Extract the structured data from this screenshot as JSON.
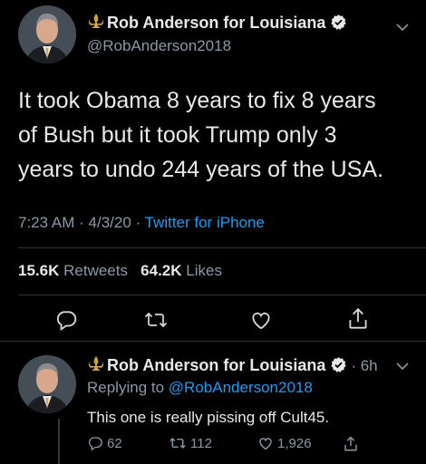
{
  "tweet": {
    "author_name": "Rob Anderson for Louisiana",
    "author_handle": "@RobAnderson2018",
    "text_lines": [
      "It took Obama 8 years to fix 8 years",
      "of Bush but it took Trump only 3",
      "years to undo 244 years of the USA."
    ],
    "time": "7:23 AM",
    "date": "4/3/20",
    "separator": "·",
    "source": "Twitter for iPhone",
    "retweets_count": "15.6K",
    "retweets_label": "Retweets",
    "likes_count": "64.2K",
    "likes_label": "Likes"
  },
  "reply": {
    "author_name": "Rob Anderson for Louisiana",
    "age": "· 6h",
    "replying_to_label": "Replying to",
    "replying_to_handle": "@RobAnderson2018",
    "text": "This one is really pissing off Cult45.",
    "reply_count": "62",
    "retweet_count": "112",
    "like_count": "1,926"
  },
  "icons": {
    "verified": "verified-badge-icon",
    "fleur": "fleur-de-lis-icon",
    "reply": "reply-icon",
    "retweet": "retweet-icon",
    "like": "heart-icon",
    "share": "share-icon",
    "more": "chevron-down-icon"
  },
  "colors": {
    "background": "#000000",
    "link": "#1d9bf0",
    "muted": "#8b98a5",
    "text": "#e7e9ea"
  }
}
